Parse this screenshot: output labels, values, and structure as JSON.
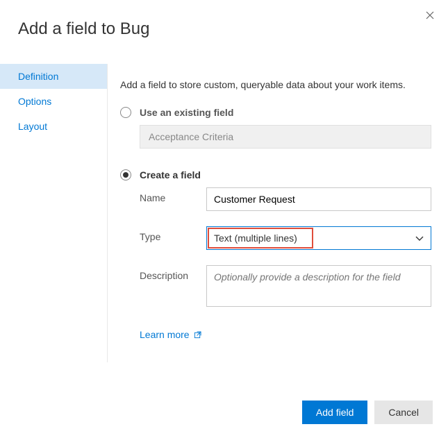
{
  "dialog": {
    "title": "Add a field to Bug",
    "intro": "Add a field to store custom, queryable data about your work items."
  },
  "sidebar": {
    "items": [
      {
        "label": "Definition",
        "active": true
      },
      {
        "label": "Options",
        "active": false
      },
      {
        "label": "Layout",
        "active": false
      }
    ]
  },
  "radios": {
    "existing_label": "Use an existing field",
    "create_label": "Create a field"
  },
  "existing": {
    "value": "Acceptance Criteria"
  },
  "form": {
    "name_label": "Name",
    "name_value": "Customer Request",
    "type_label": "Type",
    "type_value": "Text (multiple lines)",
    "desc_label": "Description",
    "desc_placeholder": "Optionally provide a description for the field"
  },
  "learn_more": "Learn more",
  "footer": {
    "primary": "Add field",
    "secondary": "Cancel"
  }
}
